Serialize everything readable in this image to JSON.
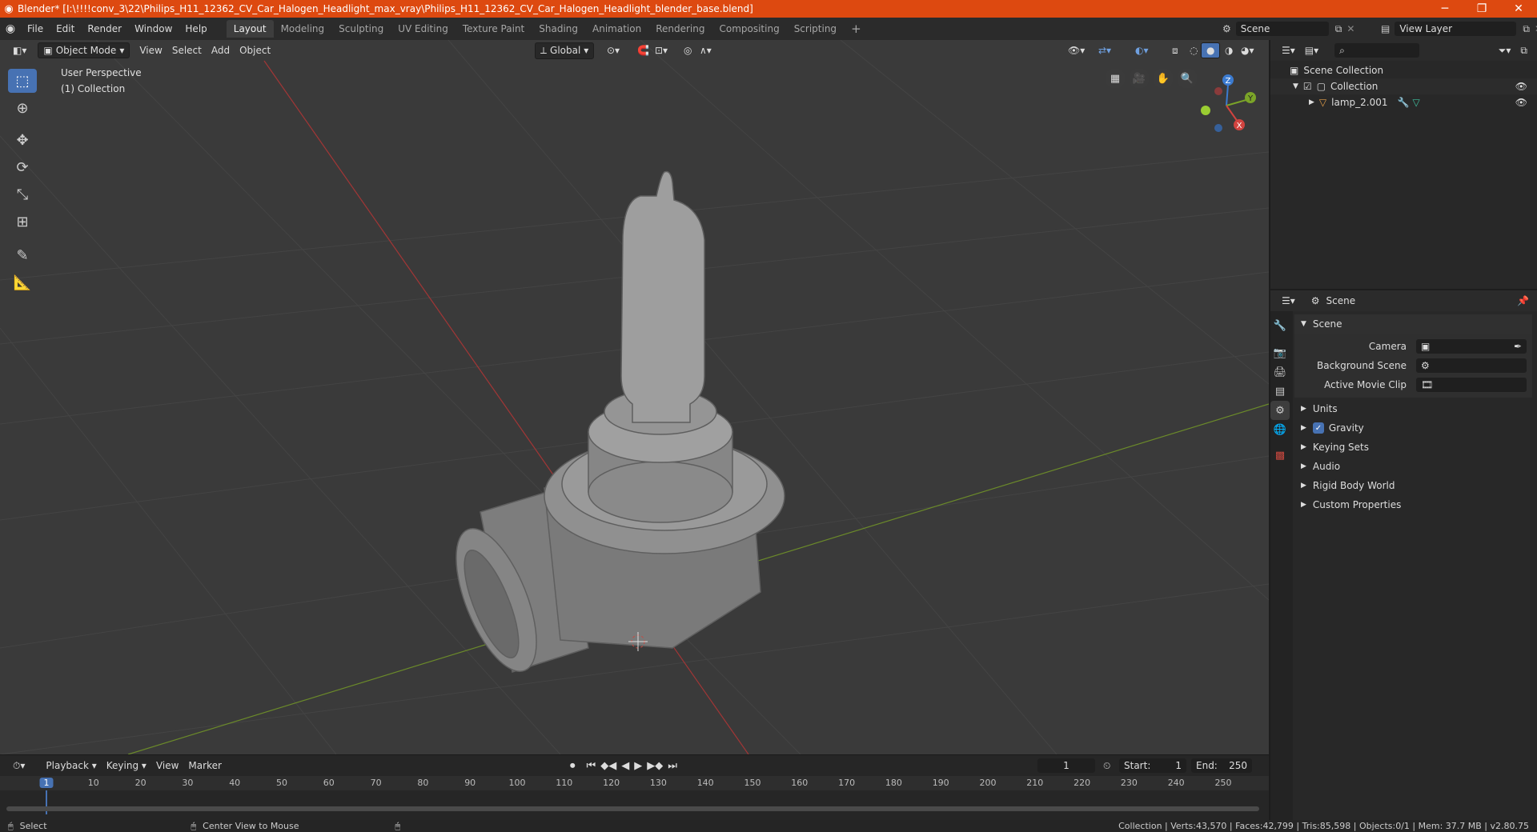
{
  "window": {
    "title": "Blender* [I:\\!!!!conv_3\\22\\Philips_H11_12362_CV_Car_Halogen_Headlight_max_vray\\Philips_H11_12362_CV_Car_Halogen_Headlight_blender_base.blend]",
    "minimize": "─",
    "maximize": "❐",
    "close": "✕"
  },
  "menu": [
    "File",
    "Edit",
    "Render",
    "Window",
    "Help"
  ],
  "workspaces": [
    "Layout",
    "Modeling",
    "Sculpting",
    "UV Editing",
    "Texture Paint",
    "Shading",
    "Animation",
    "Rendering",
    "Compositing",
    "Scripting"
  ],
  "active_workspace": "Layout",
  "scene_field": "Scene",
  "view_layer_field": "View Layer",
  "viewport": {
    "mode": "Object Mode",
    "menus": [
      "View",
      "Select",
      "Add",
      "Object"
    ],
    "transform_orientation": "Global",
    "overlay_title": "User Perspective",
    "overlay_subtitle": "(1) Collection",
    "gizmo_x": "X",
    "gizmo_y": "Y",
    "gizmo_z": "Z"
  },
  "outliner": {
    "root": "Scene Collection",
    "collection": "Collection",
    "object": "lamp_2.001"
  },
  "properties": {
    "header": "Scene",
    "section": "Scene",
    "camera_label": "Camera",
    "background_scene_label": "Background Scene",
    "active_movie_clip_label": "Active Movie Clip",
    "panels": [
      "Units",
      "Gravity",
      "Keying Sets",
      "Audio",
      "Rigid Body World",
      "Custom Properties"
    ],
    "gravity_checked": true
  },
  "timeline": {
    "menus": [
      "Playback",
      "Keying",
      "View",
      "Marker"
    ],
    "current_frame": "1",
    "start_label": "Start:",
    "start": "1",
    "end_label": "End:",
    "end": "250",
    "ruler": [
      "1",
      "10",
      "20",
      "30",
      "40",
      "50",
      "60",
      "70",
      "80",
      "90",
      "100",
      "110",
      "120",
      "130",
      "140",
      "150",
      "160",
      "170",
      "180",
      "190",
      "200",
      "210",
      "220",
      "230",
      "240",
      "250"
    ]
  },
  "status": {
    "left_action": "Select",
    "middle_action": "Center View to Mouse",
    "stats": "Collection | Verts:43,570 | Faces:42,799 | Tris:85,598 | Objects:0/1 | Mem: 37.7 MB | v2.80.75"
  },
  "colors": {
    "titlebar": "#dd4910",
    "accent": "#4772b3",
    "x_axis": "#d0433f",
    "y_axis": "#7ba428",
    "z_axis": "#3b7bd0"
  }
}
